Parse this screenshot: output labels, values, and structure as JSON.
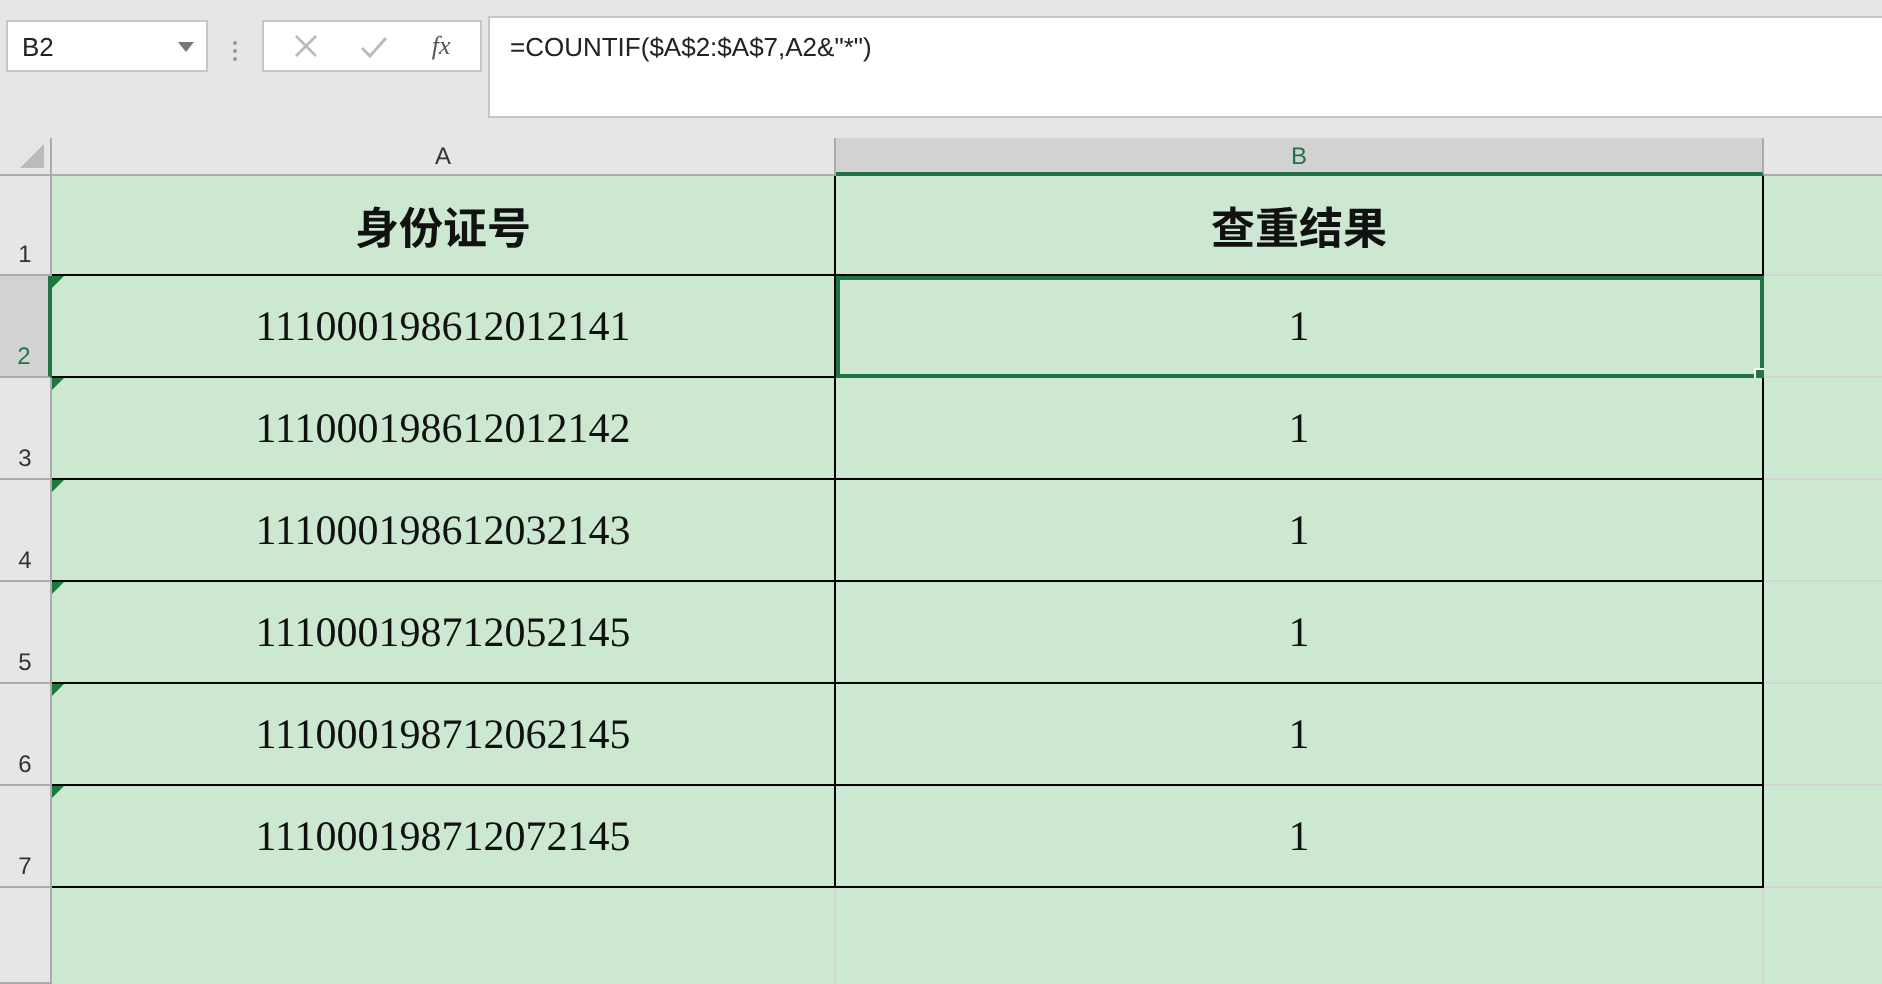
{
  "name_box": {
    "value": "B2"
  },
  "formula_bar": {
    "cancel_disabled": true,
    "enter_disabled": true,
    "fx": "fx",
    "value": "=COUNTIF($A$2:$A$7,A2&\"*\")"
  },
  "columns": [
    {
      "label": "A",
      "selected": false
    },
    {
      "label": "B",
      "selected": true
    }
  ],
  "header_row": {
    "number": "1",
    "selected": false,
    "cells": [
      "身份证号",
      "查重结果"
    ]
  },
  "rows": [
    {
      "number": "2",
      "selected": true,
      "error_marker": true,
      "cells": [
        "111000198612012141",
        "1"
      ]
    },
    {
      "number": "3",
      "selected": false,
      "error_marker": true,
      "cells": [
        "111000198612012142",
        "1"
      ]
    },
    {
      "number": "4",
      "selected": false,
      "error_marker": true,
      "cells": [
        "111000198612032143",
        "1"
      ]
    },
    {
      "number": "5",
      "selected": false,
      "error_marker": true,
      "cells": [
        "111000198712052145",
        "1"
      ]
    },
    {
      "number": "6",
      "selected": false,
      "error_marker": true,
      "cells": [
        "111000198712062145",
        "1"
      ]
    },
    {
      "number": "7",
      "selected": false,
      "error_marker": true,
      "cells": [
        "111000198712072145",
        "1"
      ]
    }
  ]
}
